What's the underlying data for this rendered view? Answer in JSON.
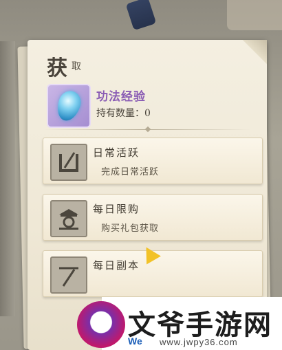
{
  "header": {
    "title_big": "获",
    "title_small": "取"
  },
  "item": {
    "name": "功法经验",
    "count_label": "持有数量：0",
    "icon": "blue-gem-icon"
  },
  "sources": [
    {
      "title": "日常活跃",
      "desc": "完成日常活跃",
      "icon": "brush-icon"
    },
    {
      "title": "每日限购",
      "desc": "购买礼包获取",
      "icon": "shop-icon"
    },
    {
      "title": "每日副本",
      "desc": "",
      "icon": "sword-icon"
    }
  ],
  "watermark": {
    "text": "文爷手游网",
    "url": "www.jwpy36.com",
    "prefix": "We"
  }
}
